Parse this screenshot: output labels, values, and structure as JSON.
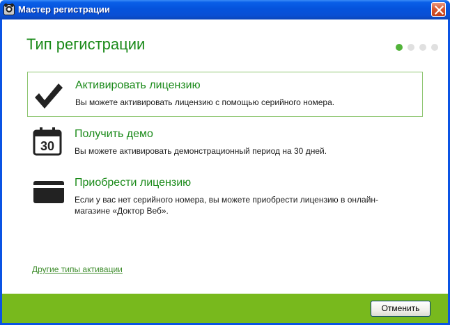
{
  "window": {
    "title": "Мастер регистрации",
    "close_icon": "close-icon"
  },
  "header": {
    "title": "Тип регистрации",
    "steps_total": 4,
    "current_step": 1
  },
  "options": [
    {
      "icon": "checkmark-icon",
      "title": "Активировать лицензию",
      "description": "Вы можете активировать лицензию с помощью серийного номера.",
      "selected": true
    },
    {
      "icon": "calendar-icon",
      "icon_text": "30",
      "title": "Получить демо",
      "description": "Вы можете активировать демонстрационный период на 30 дней.",
      "selected": false
    },
    {
      "icon": "credit-card-icon",
      "title": "Приобрести лицензию",
      "description": "Если у вас нет серийного номера, вы можете приобрести лицензию в онлайн-магазине «Доктор Веб».",
      "selected": false
    }
  ],
  "other_link": "Другие типы активации",
  "footer": {
    "cancel_label": "Отменить"
  },
  "colors": {
    "accent_green": "#1a8a19",
    "footer_green": "#78b91d",
    "titlebar_blue": "#0553dc"
  }
}
